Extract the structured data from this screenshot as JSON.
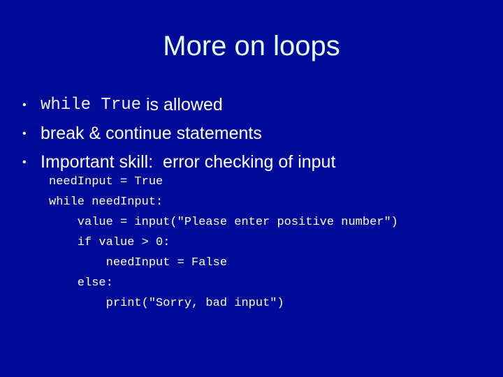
{
  "slide": {
    "title": "More on loops",
    "bullets": [
      {
        "code": "while True",
        "text": " is allowed"
      },
      {
        "text": "break & continue statements"
      },
      {
        "text": "Important skill:  error checking of input"
      }
    ],
    "bullet_glyph": "•",
    "code_lines": [
      "needInput = True",
      "while needInput:",
      "    value = input(\"Please enter positive number\")",
      "    if value > 0:",
      "        needInput = False",
      "    else:",
      "        print(\"Sorry, bad input\")"
    ]
  }
}
